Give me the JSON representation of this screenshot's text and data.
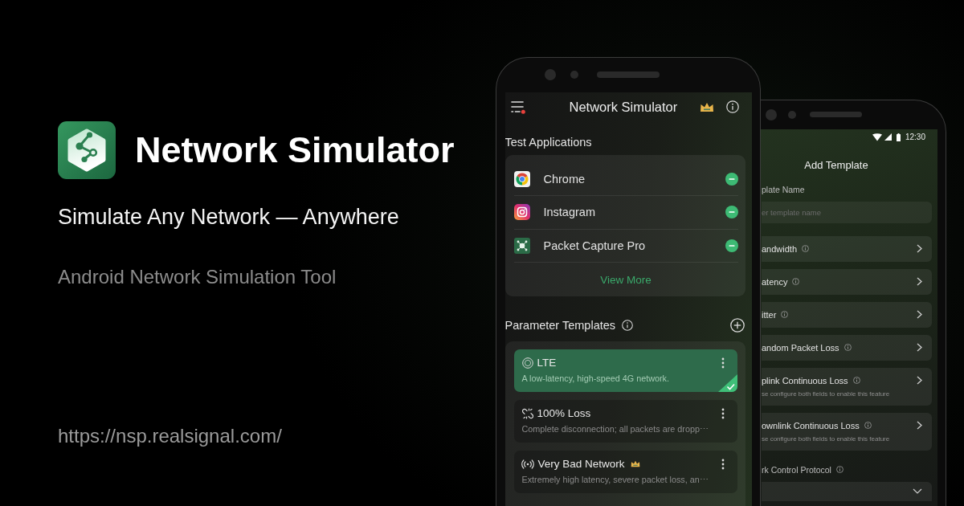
{
  "brand": {
    "title": "Network Simulator",
    "tagline": "Simulate Any Network — Anywhere",
    "subtitle": "Android Network Simulation Tool",
    "url": "https://nsp.realsignal.com/"
  },
  "main_phone": {
    "app_bar": {
      "title": "Network Simulator"
    },
    "test_applications": {
      "heading": "Test Applications",
      "apps": [
        {
          "name": "Chrome",
          "kind": "chrome"
        },
        {
          "name": "Instagram",
          "kind": "instagram"
        },
        {
          "name": "Packet Capture Pro",
          "kind": "capture"
        }
      ],
      "view_more": "View More"
    },
    "parameter_templates": {
      "heading": "Parameter Templates",
      "items": [
        {
          "name": "LTE",
          "description": "A low-latency, high-speed 4G network.",
          "kind": "lte",
          "selected": true,
          "premium": false
        },
        {
          "name": "100% Loss",
          "description": "Complete disconnection; all packets are dropp⋯",
          "kind": "loss",
          "selected": false,
          "premium": false
        },
        {
          "name": "Very Bad Network",
          "description": "Extremely high latency, severe packet loss, an⋯",
          "kind": "signal",
          "selected": false,
          "premium": true
        }
      ]
    }
  },
  "second_phone": {
    "status_bar": {
      "time": "12:30"
    },
    "title": "Add Template",
    "name_field": {
      "label": "plate Name",
      "placeholder": "er template name"
    },
    "settings": [
      {
        "label": "andwidth"
      },
      {
        "label": "atency"
      },
      {
        "label": "itter"
      },
      {
        "label": "andom Packet Loss"
      },
      {
        "label": "plink Continuous Loss",
        "hint": "se configure both fields to enable this feature"
      },
      {
        "label": "ownlink Continuous Loss",
        "hint": "se configure both fields to enable this feature"
      }
    ],
    "protocol_field": {
      "label": "rk Control Protocol"
    }
  }
}
